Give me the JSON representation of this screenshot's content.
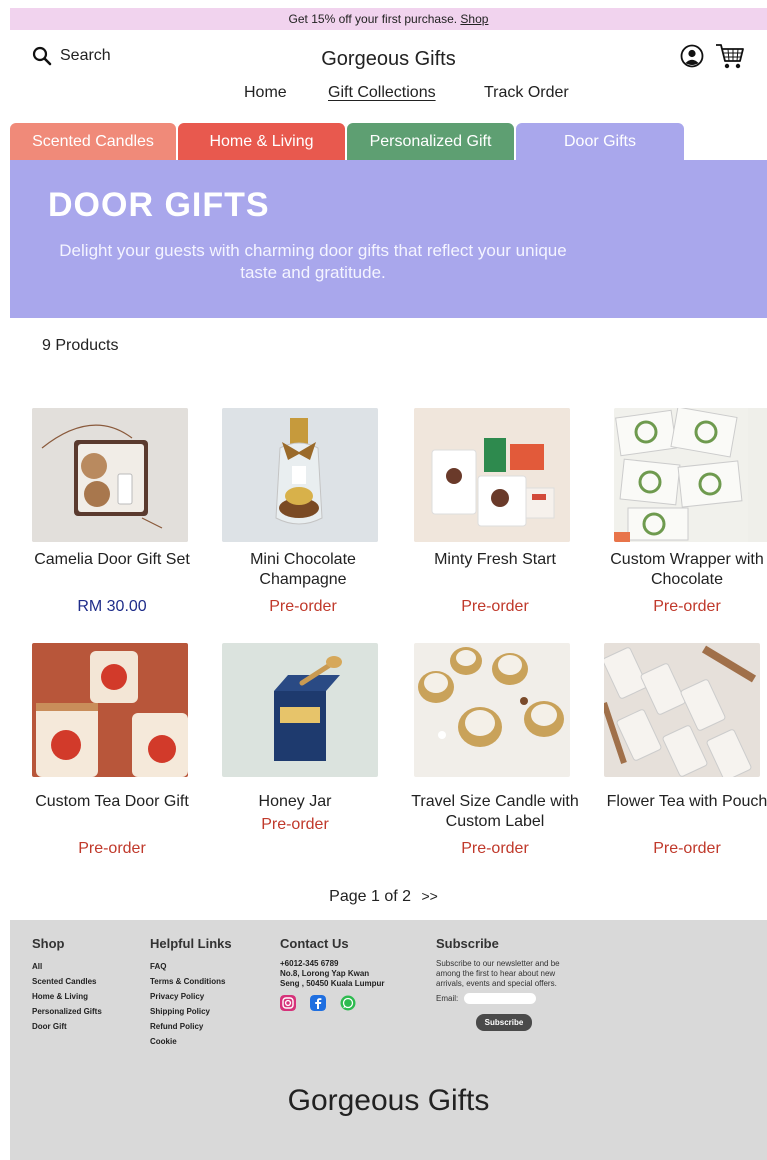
{
  "promo": {
    "text": "Get 15% off your first purchase.",
    "link": "Shop"
  },
  "header": {
    "search_label": "Search",
    "brand": "Gorgeous Gifts",
    "nav": [
      "Home",
      "Gift Collections",
      "Track Order"
    ]
  },
  "tabs": [
    {
      "label": "Scented Candles",
      "color": "#f08a79"
    },
    {
      "label": "Home & Living",
      "color": "#e8594e"
    },
    {
      "label": "Personalized Gift",
      "color": "#5e9f72"
    },
    {
      "label": "Door Gifts",
      "color": "#a9a7ec"
    }
  ],
  "hero": {
    "title": "DOOR GIFTS",
    "subtitle": "Delight your guests with charming door gifts that reflect your unique taste and gratitude."
  },
  "product_count": "9 Products",
  "products": [
    {
      "name": "Camelia Door Gift Set",
      "price": "RM 30.00",
      "status": ""
    },
    {
      "name": "Mini Chocolate Champagne",
      "price": "",
      "status": "Pre-order"
    },
    {
      "name": "Minty Fresh Start",
      "price": "",
      "status": "Pre-order"
    },
    {
      "name": "Custom Wrapper with Chocolate",
      "price": "",
      "status": "Pre-order"
    },
    {
      "name": "Custom Tea Door Gift",
      "price": "",
      "status": "Pre-order"
    },
    {
      "name": "Honey Jar",
      "price": "",
      "status": "Pre-order"
    },
    {
      "name": "Travel Size Candle with Custom Label",
      "price": "",
      "status": "Pre-order"
    },
    {
      "name": "Flower Tea with Pouch",
      "price": "",
      "status": "Pre-order"
    }
  ],
  "pagination": {
    "text": "Page 1 of 2",
    "next": ">>"
  },
  "footer": {
    "shop": {
      "title": "Shop",
      "items": [
        "All",
        "Scented Candles",
        "Home & Living",
        "Personalized Gifts",
        "Door Gift"
      ]
    },
    "helpful": {
      "title": "Helpful Links",
      "items": [
        "FAQ",
        "Terms & Conditions",
        "Privacy Policy",
        "Shipping Policy",
        "Refund Policy",
        "Cookie"
      ]
    },
    "contact": {
      "title": "Contact Us",
      "phone": "+6012-345 6789",
      "address": "No.8, Lorong Yap Kwan Seng , 50450 Kuala Lumpur"
    },
    "subscribe": {
      "title": "Subscribe",
      "text": "Subscribe to our newsletter and be among the first to hear about new arrivals, events and special offers.",
      "email_label": "Email:",
      "button": "Subscribe"
    },
    "brand": "Gorgeous Gifts"
  }
}
